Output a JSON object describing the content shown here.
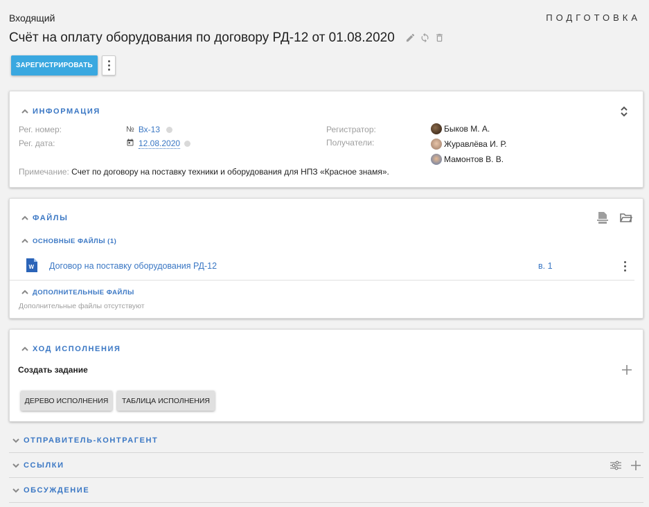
{
  "header": {
    "doc_type": "Входящий",
    "status": "ПОДГОТОВКА",
    "title": "Счёт на оплату оборудования по договору РД-12 от 01.08.2020",
    "title_icons": [
      "pencil-icon",
      "refresh-icon",
      "trash-icon"
    ]
  },
  "toolbar": {
    "register_label": "ЗАРЕГИСТРИРОВАТЬ",
    "accent_color": "#3aa8e0"
  },
  "info": {
    "title": "ИНФОРМАЦИЯ",
    "reg_number_label": "Рег. номер:",
    "reg_number_prefix": "№",
    "reg_number": "Вх-13",
    "reg_date_label": "Рег. дата:",
    "reg_date": "12.08.2020",
    "registrar_label": "Регистратор:",
    "registrar": "Быков М. А.",
    "recipients_label": "Получатели:",
    "recipients": [
      "Журавлёва И. Р.",
      "Мамонтов В. В."
    ],
    "note_label": "Примечание:",
    "note": "Счет по договору на поставку техники и оборудования для НПЗ «Красное знамя»."
  },
  "files": {
    "title": "ФАЙЛЫ",
    "main_title": "ОСНОВНЫЕ ФАЙЛЫ (1)",
    "main_files": [
      {
        "name": "Договор на поставку оборудования РД-12",
        "version": "в. 1",
        "icon": "word-doc-icon"
      }
    ],
    "extra_title": "ДОПОЛНИТЕЛЬНЫЕ ФАЙЛЫ",
    "extra_empty": "Дополнительные файлы отсутствуют"
  },
  "execution": {
    "title": "ХОД ИСПОЛНЕНИЯ",
    "create_task": "Создать задание",
    "tree_btn": "ДЕРЕВО ИСПОЛНЕНИЯ",
    "table_btn": "ТАБЛИЦА ИСПОЛНЕНИЯ"
  },
  "collapsed_sections": {
    "sender": "ОТПРАВИТЕЛЬ-КОНТРАГЕНТ",
    "links": "ССЫЛКИ",
    "discussion": "ОБСУЖДЕНИЕ"
  }
}
